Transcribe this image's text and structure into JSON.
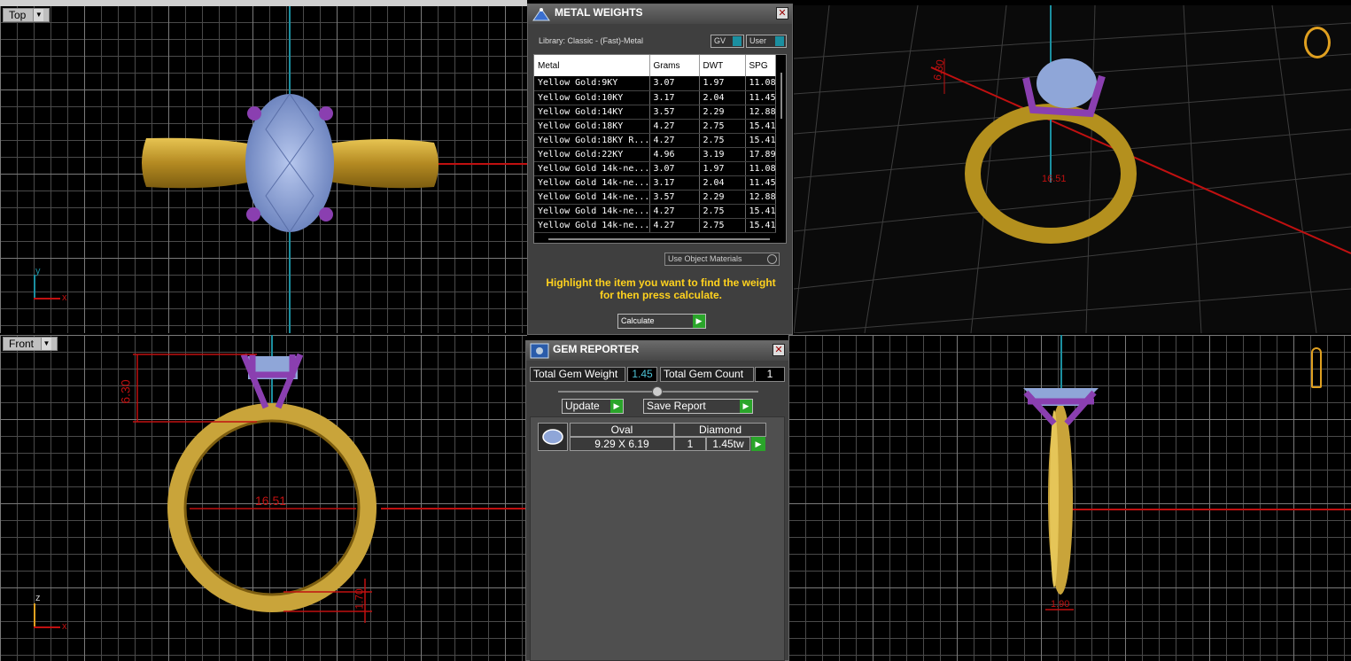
{
  "viewports": {
    "top": {
      "label": "Top",
      "axis_y": "y",
      "axis_x": "x"
    },
    "front": {
      "label": "Front",
      "axis_z": "z",
      "axis_x": "x",
      "dim_height": "6.30",
      "dim_width": "16.51",
      "dim_bottom": "1.70"
    },
    "perspective": {
      "dim_height": "6.30",
      "dim_width": "16.51"
    },
    "side": {
      "dim_bottom": "1.90"
    }
  },
  "metal_weights": {
    "title": "METAL WEIGHTS",
    "library": "Library: Classic - (Fast)-Metal",
    "gv_label": "GV",
    "user_label": "User",
    "columns": [
      "Metal",
      "Grams",
      "DWT",
      "SPG"
    ],
    "rows": [
      [
        "Yellow Gold:9KY",
        "3.07",
        "1.97",
        "11.08"
      ],
      [
        "Yellow Gold:10KY",
        "3.17",
        "2.04",
        "11.45"
      ],
      [
        "Yellow Gold:14KY",
        "3.57",
        "2.29",
        "12.88"
      ],
      [
        "Yellow Gold:18KY",
        "4.27",
        "2.75",
        "15.41"
      ],
      [
        "Yellow Gold:18KY R...",
        "4.27",
        "2.75",
        "15.41"
      ],
      [
        "Yellow Gold:22KY",
        "4.96",
        "3.19",
        "17.89"
      ],
      [
        "Yellow Gold 14k-ne...",
        "3.07",
        "1.97",
        "11.08"
      ],
      [
        "Yellow Gold 14k-ne...",
        "3.17",
        "2.04",
        "11.45"
      ],
      [
        "Yellow Gold 14k-ne...",
        "3.57",
        "2.29",
        "12.88"
      ],
      [
        "Yellow Gold 14k-ne...",
        "4.27",
        "2.75",
        "15.41"
      ],
      [
        "Yellow Gold 14k-ne...",
        "4.27",
        "2.75",
        "15.41"
      ]
    ],
    "use_object_materials": "Use Object Materials",
    "instruction": "Highlight the item you want to find the weight for then press calculate.",
    "calculate": "Calculate"
  },
  "gem_reporter": {
    "title": "GEM REPORTER",
    "total_weight_label": "Total Gem Weight",
    "total_weight_value": "1.45",
    "total_count_label": "Total Gem Count",
    "total_count_value": "1",
    "update": "Update",
    "save_report": "Save Report",
    "gems": [
      {
        "shape": "Oval",
        "size": "9.29 X 6.19",
        "material": "Diamond",
        "count": "1",
        "weight": "1.45tw"
      }
    ]
  },
  "colors": {
    "gold": "#c9a43a",
    "prong": "#8a3fb0",
    "gem": "#8fa6d8",
    "accent": "#ffd21e",
    "dim": "#e01010"
  }
}
